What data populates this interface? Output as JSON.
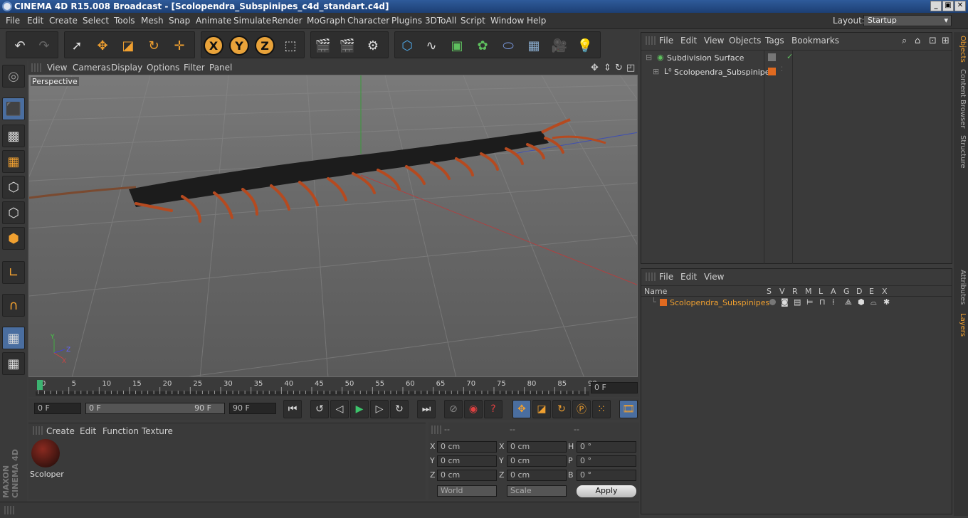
{
  "window": {
    "title": "CINEMA 4D R15.008 Broadcast - [Scolopendra_Subspinipes_c4d_standart.c4d]",
    "minimize": "_",
    "maximize": "▣",
    "close": "✕"
  },
  "menubar": {
    "items": [
      "File",
      "Edit",
      "Create",
      "Select",
      "Tools",
      "Mesh",
      "Snap",
      "Animate",
      "Simulate",
      "Render",
      "MoGraph",
      "Character",
      "Plugins",
      "3DToAll",
      "Script",
      "Window",
      "Help"
    ],
    "layout_label": "Layout:",
    "layout_value": "Startup"
  },
  "toolbar": {
    "axis_x": "X",
    "axis_y": "Y",
    "axis_z": "Z"
  },
  "viewport": {
    "menu": [
      "View",
      "Cameras",
      "Display",
      "Options",
      "Filter",
      "Panel"
    ],
    "label": "Perspective"
  },
  "timeline": {
    "ticks": [
      "0",
      "5",
      "10",
      "15",
      "20",
      "25",
      "30",
      "35",
      "40",
      "45",
      "50",
      "55",
      "60",
      "65",
      "70",
      "75",
      "80",
      "85",
      "90"
    ],
    "current_frame": "0 F"
  },
  "playbar": {
    "start_field": "0 F",
    "range_start": "0 F",
    "range_end": "90 F",
    "end_field": "90 F"
  },
  "materials": {
    "menu": [
      "Create",
      "Edit",
      "Function",
      "Texture"
    ],
    "items": [
      {
        "name": "Scoloper"
      }
    ]
  },
  "coords": {
    "headers": [
      "--",
      "--",
      "--"
    ],
    "rows": [
      {
        "axis": "X",
        "pos": "0 cm",
        "axis2": "X",
        "size": "0 cm",
        "rot_axis": "H",
        "rot": "0 °"
      },
      {
        "axis": "Y",
        "pos": "0 cm",
        "axis2": "Y",
        "size": "0 cm",
        "rot_axis": "P",
        "rot": "0 °"
      },
      {
        "axis": "Z",
        "pos": "0 cm",
        "axis2": "Z",
        "size": "0 cm",
        "rot_axis": "B",
        "rot": "0 °"
      }
    ],
    "mode": "World",
    "scale": "Scale",
    "apply": "Apply"
  },
  "objects": {
    "menu": [
      "File",
      "Edit",
      "View",
      "Objects",
      "Tags",
      "Bookmarks"
    ],
    "items": [
      {
        "name": "Subdivision Surface"
      },
      {
        "name": "Scolopendra_Subspinipes"
      }
    ]
  },
  "layers": {
    "menu": [
      "File",
      "Edit",
      "View"
    ],
    "columns": [
      "Name",
      "S",
      "V",
      "R",
      "M",
      "L",
      "A",
      "G",
      "D",
      "E",
      "X"
    ],
    "items": [
      {
        "name": "Scolopendra_Subspinipes"
      }
    ]
  },
  "sidetabs": [
    "Objects",
    "Content Browser",
    "Structure",
    "Attributes",
    "Layers"
  ],
  "brand": {
    "line1": "MAXON",
    "line2": "CINEMA 4D"
  },
  "colors": {
    "accent": "#f0a030",
    "layer_color": "#e06a20",
    "active_tab": "#4a6ea0"
  }
}
